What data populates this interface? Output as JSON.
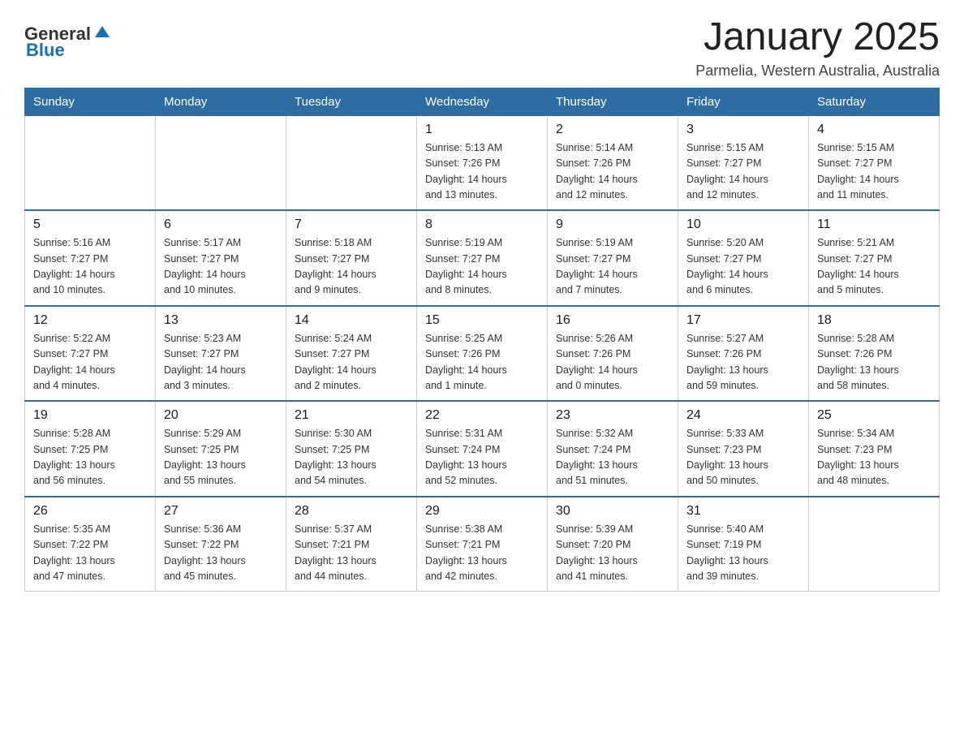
{
  "header": {
    "logo": {
      "general": "General",
      "blue": "Blue"
    },
    "title": "January 2025",
    "location": "Parmelia, Western Australia, Australia"
  },
  "weekdays": [
    "Sunday",
    "Monday",
    "Tuesday",
    "Wednesday",
    "Thursday",
    "Friday",
    "Saturday"
  ],
  "weeks": [
    [
      {
        "day": "",
        "info": ""
      },
      {
        "day": "",
        "info": ""
      },
      {
        "day": "",
        "info": ""
      },
      {
        "day": "1",
        "info": "Sunrise: 5:13 AM\nSunset: 7:26 PM\nDaylight: 14 hours\nand 13 minutes."
      },
      {
        "day": "2",
        "info": "Sunrise: 5:14 AM\nSunset: 7:26 PM\nDaylight: 14 hours\nand 12 minutes."
      },
      {
        "day": "3",
        "info": "Sunrise: 5:15 AM\nSunset: 7:27 PM\nDaylight: 14 hours\nand 12 minutes."
      },
      {
        "day": "4",
        "info": "Sunrise: 5:15 AM\nSunset: 7:27 PM\nDaylight: 14 hours\nand 11 minutes."
      }
    ],
    [
      {
        "day": "5",
        "info": "Sunrise: 5:16 AM\nSunset: 7:27 PM\nDaylight: 14 hours\nand 10 minutes."
      },
      {
        "day": "6",
        "info": "Sunrise: 5:17 AM\nSunset: 7:27 PM\nDaylight: 14 hours\nand 10 minutes."
      },
      {
        "day": "7",
        "info": "Sunrise: 5:18 AM\nSunset: 7:27 PM\nDaylight: 14 hours\nand 9 minutes."
      },
      {
        "day": "8",
        "info": "Sunrise: 5:19 AM\nSunset: 7:27 PM\nDaylight: 14 hours\nand 8 minutes."
      },
      {
        "day": "9",
        "info": "Sunrise: 5:19 AM\nSunset: 7:27 PM\nDaylight: 14 hours\nand 7 minutes."
      },
      {
        "day": "10",
        "info": "Sunrise: 5:20 AM\nSunset: 7:27 PM\nDaylight: 14 hours\nand 6 minutes."
      },
      {
        "day": "11",
        "info": "Sunrise: 5:21 AM\nSunset: 7:27 PM\nDaylight: 14 hours\nand 5 minutes."
      }
    ],
    [
      {
        "day": "12",
        "info": "Sunrise: 5:22 AM\nSunset: 7:27 PM\nDaylight: 14 hours\nand 4 minutes."
      },
      {
        "day": "13",
        "info": "Sunrise: 5:23 AM\nSunset: 7:27 PM\nDaylight: 14 hours\nand 3 minutes."
      },
      {
        "day": "14",
        "info": "Sunrise: 5:24 AM\nSunset: 7:27 PM\nDaylight: 14 hours\nand 2 minutes."
      },
      {
        "day": "15",
        "info": "Sunrise: 5:25 AM\nSunset: 7:26 PM\nDaylight: 14 hours\nand 1 minute."
      },
      {
        "day": "16",
        "info": "Sunrise: 5:26 AM\nSunset: 7:26 PM\nDaylight: 14 hours\nand 0 minutes."
      },
      {
        "day": "17",
        "info": "Sunrise: 5:27 AM\nSunset: 7:26 PM\nDaylight: 13 hours\nand 59 minutes."
      },
      {
        "day": "18",
        "info": "Sunrise: 5:28 AM\nSunset: 7:26 PM\nDaylight: 13 hours\nand 58 minutes."
      }
    ],
    [
      {
        "day": "19",
        "info": "Sunrise: 5:28 AM\nSunset: 7:25 PM\nDaylight: 13 hours\nand 56 minutes."
      },
      {
        "day": "20",
        "info": "Sunrise: 5:29 AM\nSunset: 7:25 PM\nDaylight: 13 hours\nand 55 minutes."
      },
      {
        "day": "21",
        "info": "Sunrise: 5:30 AM\nSunset: 7:25 PM\nDaylight: 13 hours\nand 54 minutes."
      },
      {
        "day": "22",
        "info": "Sunrise: 5:31 AM\nSunset: 7:24 PM\nDaylight: 13 hours\nand 52 minutes."
      },
      {
        "day": "23",
        "info": "Sunrise: 5:32 AM\nSunset: 7:24 PM\nDaylight: 13 hours\nand 51 minutes."
      },
      {
        "day": "24",
        "info": "Sunrise: 5:33 AM\nSunset: 7:23 PM\nDaylight: 13 hours\nand 50 minutes."
      },
      {
        "day": "25",
        "info": "Sunrise: 5:34 AM\nSunset: 7:23 PM\nDaylight: 13 hours\nand 48 minutes."
      }
    ],
    [
      {
        "day": "26",
        "info": "Sunrise: 5:35 AM\nSunset: 7:22 PM\nDaylight: 13 hours\nand 47 minutes."
      },
      {
        "day": "27",
        "info": "Sunrise: 5:36 AM\nSunset: 7:22 PM\nDaylight: 13 hours\nand 45 minutes."
      },
      {
        "day": "28",
        "info": "Sunrise: 5:37 AM\nSunset: 7:21 PM\nDaylight: 13 hours\nand 44 minutes."
      },
      {
        "day": "29",
        "info": "Sunrise: 5:38 AM\nSunset: 7:21 PM\nDaylight: 13 hours\nand 42 minutes."
      },
      {
        "day": "30",
        "info": "Sunrise: 5:39 AM\nSunset: 7:20 PM\nDaylight: 13 hours\nand 41 minutes."
      },
      {
        "day": "31",
        "info": "Sunrise: 5:40 AM\nSunset: 7:19 PM\nDaylight: 13 hours\nand 39 minutes."
      },
      {
        "day": "",
        "info": ""
      }
    ]
  ]
}
